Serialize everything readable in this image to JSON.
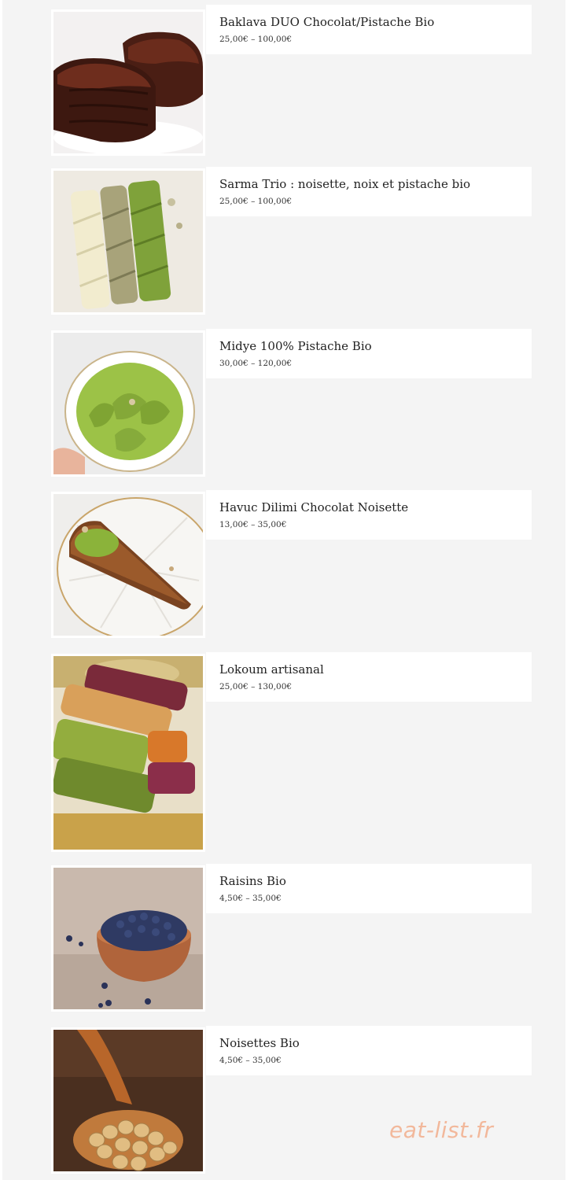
{
  "products": [
    {
      "title": "Baklava DUO Chocolat/Pistache Bio",
      "price": "25,00€ – 100,00€",
      "image": "baklava-chocolate-photo"
    },
    {
      "title": "Sarma Trio : noisette, noix et pistache bio",
      "price": "25,00€ – 100,00€",
      "image": "sarma-trio-photo"
    },
    {
      "title": "Midye 100% Pistache Bio",
      "price": "30,00€ – 120,00€",
      "image": "midye-pistachio-photo"
    },
    {
      "title": "Havuc Dilimi Chocolat Noisette",
      "price": "13,00€ – 35,00€",
      "image": "havuc-dilimi-photo"
    },
    {
      "title": "Lokoum artisanal",
      "price": "25,00€ – 130,00€",
      "image": "lokoum-photo"
    },
    {
      "title": "Raisins Bio",
      "price": "4,50€ – 35,00€",
      "image": "raisins-bowl-photo"
    },
    {
      "title": "Noisettes Bio",
      "price": "4,50€ – 35,00€",
      "image": "hazelnuts-spoon-photo"
    }
  ],
  "watermark": "eat-list.fr",
  "colors": {
    "page_background": "#f4f4f4",
    "card_background": "#ffffff",
    "watermark": "#f2b89b"
  }
}
